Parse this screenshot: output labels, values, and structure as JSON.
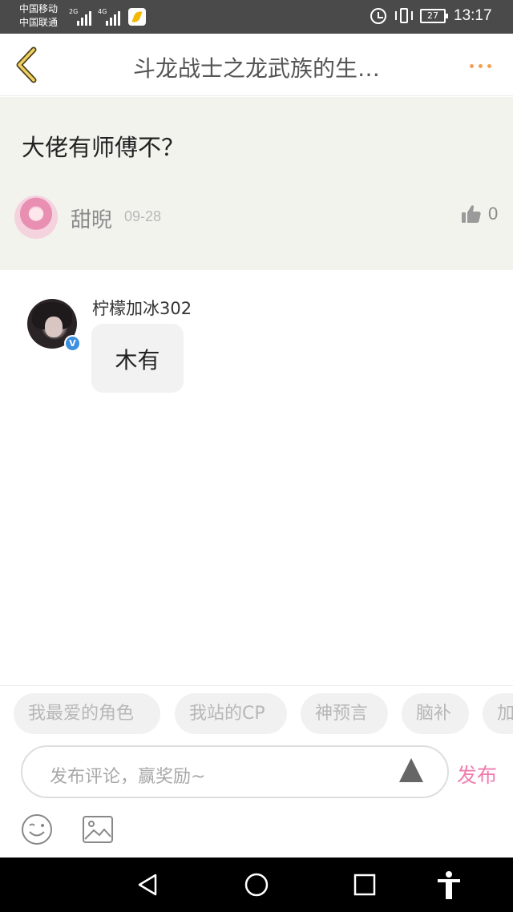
{
  "status_bar": {
    "carrier_1": "中国移动",
    "carrier_2": "中国联通",
    "signal_1_label": "2G",
    "signal_2_label": "4G",
    "battery": "27",
    "time": "13:17"
  },
  "header": {
    "title": "斗龙战士之龙武族的生…",
    "back_icon": "chevron-left-icon",
    "more_icon": "more-dots-icon",
    "accent_color": "#f5a050"
  },
  "question": {
    "text": "大佬有师傅不？",
    "author": "甜晲",
    "date": "09-28",
    "like_count": "0"
  },
  "replies": [
    {
      "author": "柠檬加冰302",
      "verified": true,
      "text": "木有"
    }
  ],
  "tags": [
    "我最爱的角色",
    "我站的CP",
    "神预言",
    "脑补",
    "加"
  ],
  "composer": {
    "placeholder": "发布评论，赢奖励~",
    "publish_label": "发布",
    "publish_color": "#f07cae"
  }
}
